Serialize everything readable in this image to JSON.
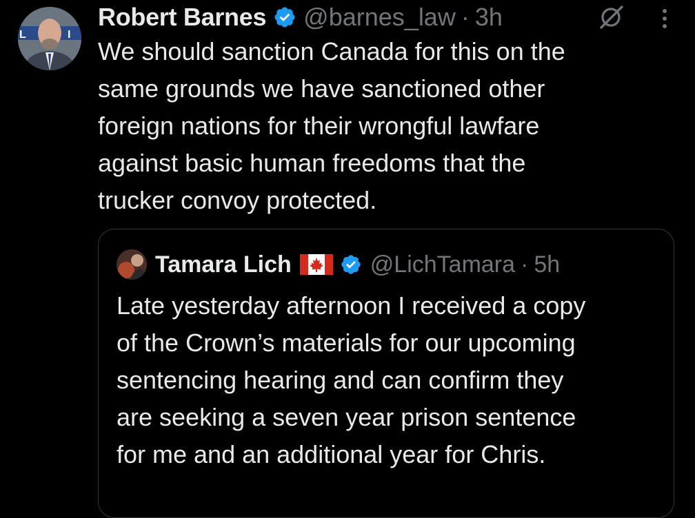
{
  "tweet": {
    "author_name": "Robert Barnes",
    "handle": "@barnes_law",
    "separator": "·",
    "time": "3h",
    "verified_icon": "verified-badge-icon",
    "lines": [
      "We should sanction Canada for this on the",
      "same grounds we have sanctioned other",
      "foreign nations for their wrongful lawfare",
      "against basic human freedoms that the",
      "trucker convoy protected."
    ]
  },
  "quote": {
    "author_name": "Tamara Lich",
    "handle": "@LichTamara",
    "separator": "·",
    "time": "5h",
    "flag_icon": "canada-flag-icon",
    "lines": [
      "Late yesterday afternoon I received a copy",
      "of the Crown’s materials for our upcoming",
      "sentencing hearing and can confirm they",
      "are seeking a seven year prison sentence",
      "for me and an additional year for Chris."
    ]
  },
  "icons": {
    "grok": "grok-icon",
    "more": "more-options-icon"
  },
  "colors": {
    "background": "#000000",
    "text_primary": "#e7e9ea",
    "text_secondary": "#71767b",
    "verified_blue": "#1d9bf0",
    "border": "#333639"
  }
}
